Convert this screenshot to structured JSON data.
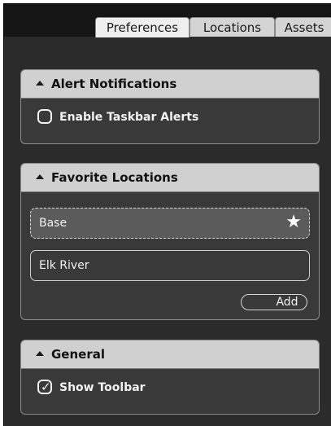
{
  "tabs": [
    {
      "label": "Preferences",
      "active": true
    },
    {
      "label": "Locations",
      "active": false
    },
    {
      "label": "Assets",
      "active": false
    }
  ],
  "alert_panel": {
    "title": "Alert Notifications",
    "enable_taskbar_alerts": {
      "label": "Enable Taskbar Alerts",
      "checked": false
    }
  },
  "favorites_panel": {
    "title": "Favorite Locations",
    "locations": [
      {
        "name": "Base",
        "favorite": true,
        "selected": true
      },
      {
        "name": "Elk River",
        "favorite": false,
        "selected": false
      }
    ],
    "add_label": "Add"
  },
  "general_panel": {
    "title": "General",
    "show_toolbar": {
      "label": "Show Toolbar",
      "checked": true,
      "checkmark": "✓"
    }
  },
  "icons": {
    "collapse": "triangle-up",
    "favorite": "star",
    "star_glyph": "★"
  },
  "colors": {
    "background": "#2b2b2b",
    "tab_strip": "#151515",
    "panel_header": "#d0d0d0",
    "panel_body": "#393939",
    "selected_item": "#5b5b5b"
  }
}
